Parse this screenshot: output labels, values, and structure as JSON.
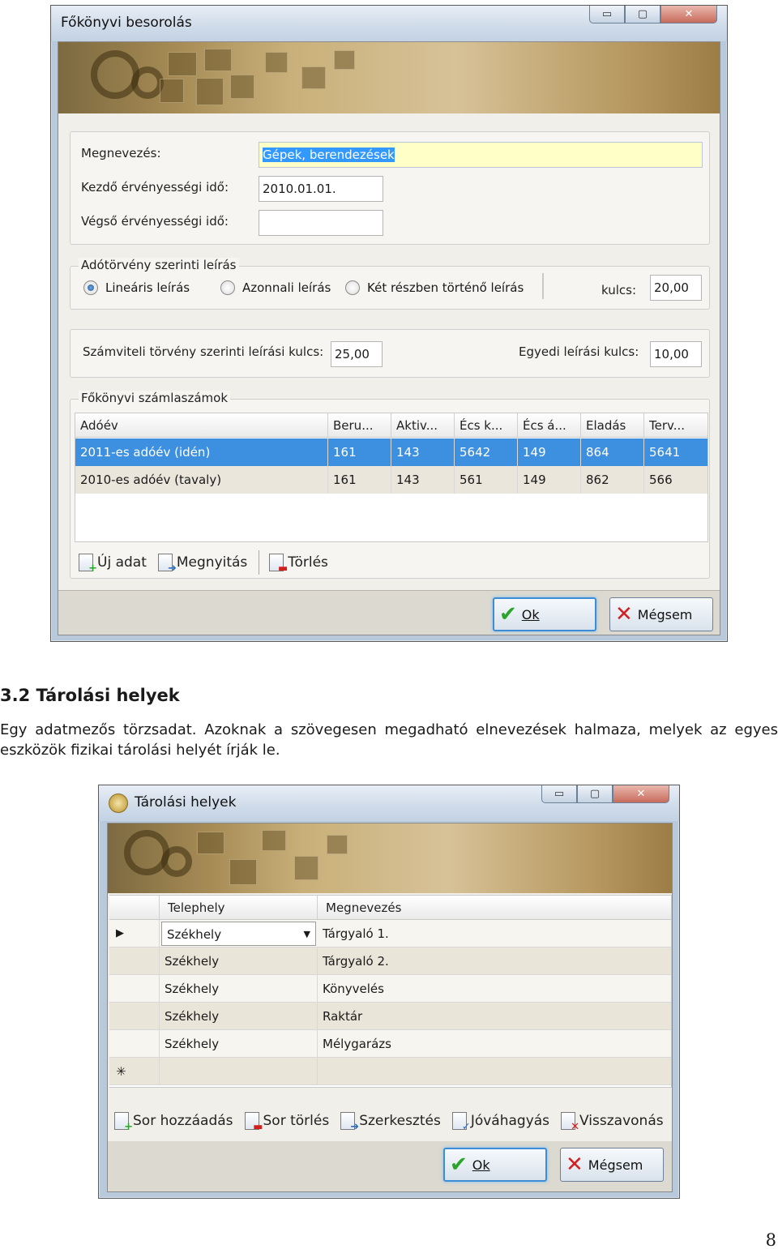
{
  "window1": {
    "title": "Főkönyvi besorolás",
    "controls": [
      "▭",
      "▢",
      "✕"
    ],
    "fields": {
      "name_label": "Megnevezés:",
      "name_value": "Gépek, berendezések",
      "start_label": "Kezdő érvényességi idő:",
      "start_value": "2010.01.01.",
      "end_label": "Végső érvényességi idő:",
      "end_value": ""
    },
    "tax_group": {
      "title": "Adótörvény szerinti leírás",
      "options": [
        "Lineáris leírás",
        "Azonnali leírás",
        "Két részben történő leírás"
      ],
      "selected": "Lineáris leírás",
      "rate_label": "kulcs:",
      "rate_value": "20,00"
    },
    "accounting": {
      "rate_label": "Számviteli törvény szerinti leírási kulcs:",
      "rate_value": "25,00",
      "custom_label": "Egyedi leírási kulcs:",
      "custom_value": "10,00"
    },
    "ledger": {
      "title": "Főkönyvi számlaszámok",
      "columns": [
        "Adóév",
        "Beru...",
        "Aktiv...",
        "Écs k...",
        "Écs á...",
        "Eladás",
        "Terv..."
      ],
      "rows": [
        [
          "2011-es adóév (idén)",
          "161",
          "143",
          "5642",
          "149",
          "864",
          "5641"
        ],
        [
          "2010-es adóév (tavaly)",
          "161",
          "143",
          "561",
          "149",
          "862",
          "566"
        ]
      ],
      "toolbar": {
        "new": "Új adat",
        "open": "Megnyitás",
        "delete": "Törlés"
      }
    },
    "buttons": {
      "ok": "Ok",
      "cancel": "Mégsem"
    }
  },
  "document": {
    "heading": "3.2 Tárolási helyek",
    "paragraph": "Egy adatmezős törzsadat. Azoknak a szövegesen megadható elnevezések halmaza, melyek az egyes eszközök fizikai tárolási helyét írják le.",
    "page_number": "8"
  },
  "window2": {
    "title": "Tárolási helyek",
    "controls": [
      "▭",
      "▢",
      "✕"
    ],
    "columns": [
      "Telephely",
      "Megnevezés"
    ],
    "rows": [
      [
        "Székhely",
        "Tárgyaló 1."
      ],
      [
        "Székhely",
        "Tárgyaló 2."
      ],
      [
        "Székhely",
        "Könyvelés"
      ],
      [
        "Székhely",
        "Raktár"
      ],
      [
        "Székhely",
        "Mélygarázs"
      ]
    ],
    "current_row_marker": "▶",
    "new_row_marker": "✳",
    "dropdown_arrow": "▼",
    "toolbar": {
      "add": "Sor hozzáadás",
      "delete": "Sor törlés",
      "edit": "Szerkesztés",
      "approve": "Jóváhagyás",
      "revert": "Visszavonás"
    },
    "buttons": {
      "ok": "Ok",
      "cancel": "Mégsem"
    }
  },
  "icons": [
    "check-icon",
    "close-x-icon",
    "document-add-icon",
    "document-arrow-icon",
    "document-delete-icon",
    "app-icon",
    "dropdown-arrow-icon",
    "row-pointer-icon",
    "new-row-icon"
  ],
  "colors": {
    "selection": "#3d8fe0",
    "highlight_field": "#ffffc8",
    "banner": "#c9b07a",
    "ok_check": "#2aa52a",
    "cancel_x": "#d02020"
  }
}
